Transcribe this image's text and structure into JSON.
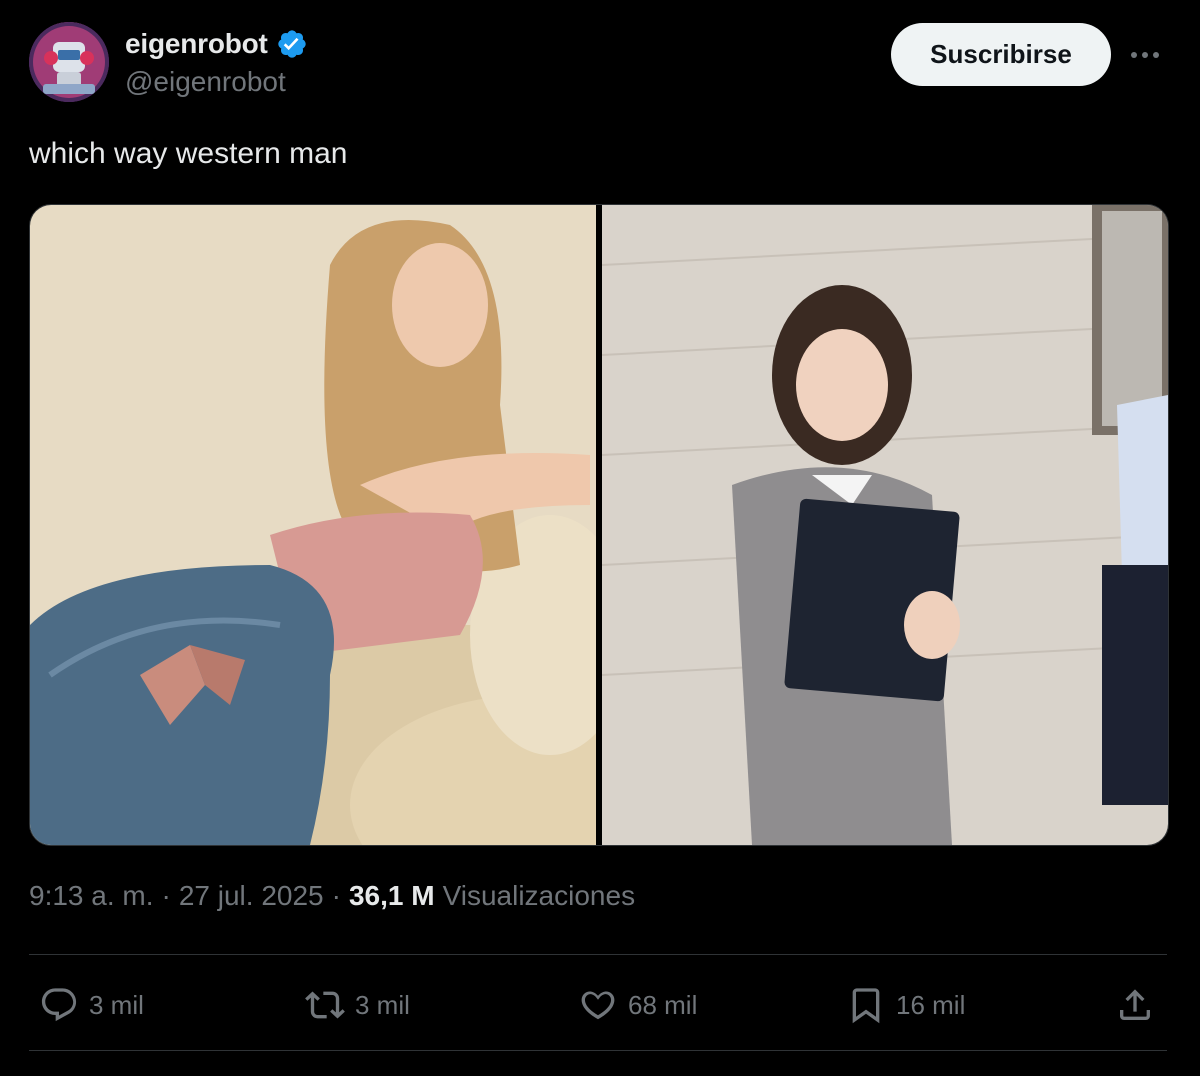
{
  "author": {
    "name": "eigenrobot",
    "handle": "@eigenrobot",
    "avatar_icon": "robot-avatar-icon",
    "verified_icon": "verified-badge-icon"
  },
  "header": {
    "subscribe_label": "Suscribirse",
    "more_icon": "more-horizontal-icon"
  },
  "tweet": {
    "text": "which way western man"
  },
  "media": {
    "images": [
      {
        "description_icon": "photo-left"
      },
      {
        "description_icon": "photo-right"
      }
    ]
  },
  "meta": {
    "time": "9:13 a. m.",
    "separator1": "·",
    "date": "27 jul. 2025",
    "separator2": "·",
    "views_count": "36,1 M",
    "views_label": "Visualizaciones"
  },
  "actions": {
    "reply": {
      "icon": "reply-icon",
      "count": "3 mil"
    },
    "repost": {
      "icon": "repost-icon",
      "count": "3 mil"
    },
    "like": {
      "icon": "like-icon",
      "count": "68 mil"
    },
    "bookmark": {
      "icon": "bookmark-icon",
      "count": "16 mil"
    },
    "share": {
      "icon": "share-icon"
    }
  },
  "colors": {
    "background": "#000000",
    "text_primary": "#e7e9ea",
    "text_secondary": "#71767b",
    "verified": "#1d9bf0",
    "button_bg": "#eff3f4"
  }
}
